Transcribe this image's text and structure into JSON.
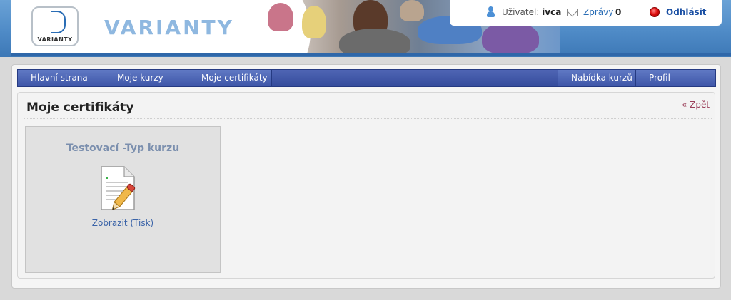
{
  "header": {
    "logo_small_text": "VARIANTY",
    "brand_text": "VARIANTY",
    "user_label": "Uživatel:",
    "user_name": "ivca",
    "messages_label": "Zprávy",
    "messages_count": "0",
    "logout_label": "Odhlásit"
  },
  "nav": {
    "items": [
      {
        "label": "Hlavní strana"
      },
      {
        "label": "Moje kurzy"
      },
      {
        "label": "Moje certifikáty"
      }
    ],
    "right_items": [
      {
        "label": "Nabídka kurzů"
      },
      {
        "label": "Profil"
      }
    ]
  },
  "page": {
    "title": "Moje certifikáty",
    "back_label": "« Zpět"
  },
  "certificates": [
    {
      "title": "Testovací -Typ kurzu",
      "icon": "certificate-document-pencil-icon",
      "link_label": "Zobrazit (Tisk)"
    }
  ],
  "colors": {
    "header_blue": "#4f8bc7",
    "nav_blue": "#3e56a8",
    "card_title": "#7b8fae",
    "link": "#3a63a8",
    "back_link": "#9b3f5a",
    "logout_red": "#e01010"
  }
}
